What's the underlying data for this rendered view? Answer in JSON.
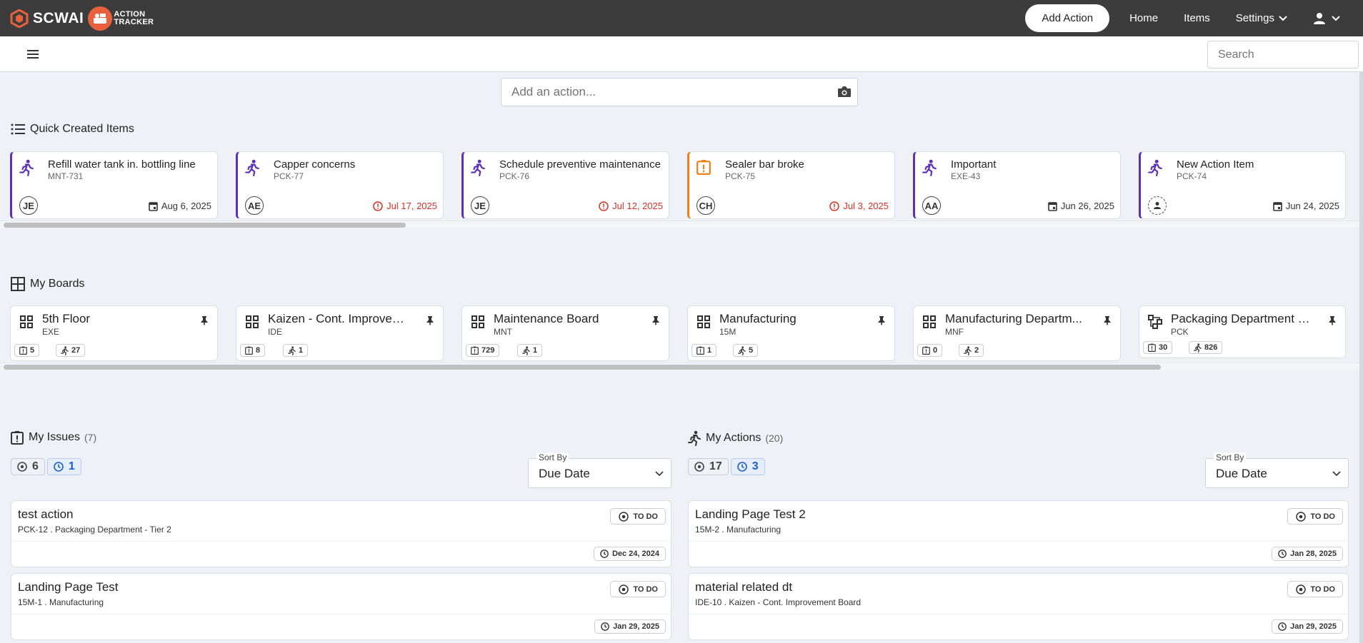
{
  "nav": {
    "brand": "SCWAI",
    "app_name_line1": "ACTION",
    "app_name_line2": "TRACKER",
    "add_action": "Add Action",
    "home": "Home",
    "items": "Items",
    "settings": "Settings"
  },
  "search": {
    "placeholder": "Search"
  },
  "add_input": {
    "placeholder": "Add an action..."
  },
  "quick_items": {
    "title": "Quick Created Items",
    "items": [
      {
        "title": "Refill water tank in. bottling line",
        "code": "MNT-731",
        "avatar": "JE",
        "date": "Aug 6, 2025",
        "overdue": false,
        "type": "action"
      },
      {
        "title": "Capper concerns",
        "code": "PCK-77",
        "avatar": "AE",
        "date": "Jul 17, 2025",
        "overdue": true,
        "type": "action"
      },
      {
        "title": "Schedule preventive maintenance",
        "code": "PCK-76",
        "avatar": "JE",
        "date": "Jul 12, 2025",
        "overdue": true,
        "type": "action"
      },
      {
        "title": "Sealer bar broke",
        "code": "PCK-75",
        "avatar": "CH",
        "date": "Jul 3, 2025",
        "overdue": true,
        "type": "issue"
      },
      {
        "title": "Important",
        "code": "EXE-43",
        "avatar": "AA",
        "date": "Jun 26, 2025",
        "overdue": false,
        "type": "action"
      },
      {
        "title": "New Action Item",
        "code": "PCK-74",
        "avatar": "",
        "date": "Jun 24, 2025",
        "overdue": false,
        "type": "action"
      }
    ]
  },
  "boards": {
    "title": "My Boards",
    "items": [
      {
        "title": "5th Floor",
        "code": "EXE",
        "issues": "5",
        "actions": "27"
      },
      {
        "title": "Kaizen - Cont. Improvem...",
        "code": "IDE",
        "issues": "8",
        "actions": "1"
      },
      {
        "title": "Maintenance Board",
        "code": "MNT",
        "issues": "729",
        "actions": "1"
      },
      {
        "title": "Manufacturing",
        "code": "15M",
        "issues": "1",
        "actions": "5"
      },
      {
        "title": "Manufacturing Departm...",
        "code": "MNF",
        "issues": "0",
        "actions": "2"
      },
      {
        "title": "Packaging Department - T...",
        "code": "PCK",
        "issues": "30",
        "actions": "826"
      }
    ]
  },
  "issues": {
    "title": "My Issues",
    "count": "(7)",
    "open": "6",
    "pending": "1",
    "sort_label": "Sort By",
    "sort_value": "Due Date",
    "items": [
      {
        "title": "test action",
        "sub": "PCK-12 . Packaging Department - Tier 2",
        "status": "TO DO",
        "date": "Dec 24, 2024"
      },
      {
        "title": "Landing Page Test",
        "sub": "15M-1 . Manufacturing",
        "status": "TO DO",
        "date": "Jan 29, 2025"
      }
    ]
  },
  "actions": {
    "title": "My Actions",
    "count": "(20)",
    "open": "17",
    "pending": "3",
    "sort_label": "Sort By",
    "sort_value": "Due Date",
    "items": [
      {
        "title": "Landing Page Test 2",
        "sub": "15M-2 . Manufacturing",
        "status": "TO DO",
        "date": "Jan 28, 2025"
      },
      {
        "title": "material related dt",
        "sub": "IDE-10 . Kaizen - Cont. Improvement Board",
        "status": "TO DO",
        "date": "Jan 29, 2025"
      }
    ]
  },
  "colors": {
    "accent": "#5b2fb8",
    "issue": "#ef7f1a",
    "overdue": "#d93025",
    "topbar": "#3c3c3c"
  }
}
